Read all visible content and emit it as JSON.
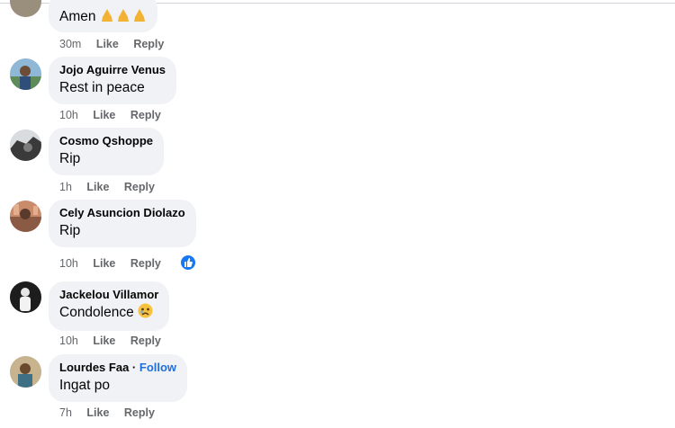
{
  "comments": [
    {
      "author": "",
      "text": "Amen",
      "emoji": "folded-hands-x3",
      "time": "30m",
      "like": "Like",
      "reply": "Reply"
    },
    {
      "author": "Jojo Aguirre Venus",
      "text": "Rest in peace",
      "time": "10h",
      "like": "Like",
      "reply": "Reply"
    },
    {
      "author": "Cosmo Qshoppe",
      "text": "Rip",
      "time": "1h",
      "like": "Like",
      "reply": "Reply"
    },
    {
      "author": "Cely Asuncion Diolazo",
      "text": "Rip",
      "time": "10h",
      "like": "Like",
      "reply": "Reply",
      "reaction": "like-reaction-icon"
    },
    {
      "author": "Jackelou Villamor",
      "text": "Condolence",
      "emoji": "sad-face",
      "time": "10h",
      "like": "Like",
      "reply": "Reply"
    },
    {
      "author": "Lourdes Faa",
      "follow_separator": "·",
      "follow": "Follow",
      "text": "Ingat po",
      "time": "7h",
      "like": "Like",
      "reply": "Reply"
    }
  ],
  "colors": {
    "bubble": "#f0f2f5",
    "meta": "#65676b",
    "link": "#216fdb",
    "like_blue": "#1877f2"
  }
}
